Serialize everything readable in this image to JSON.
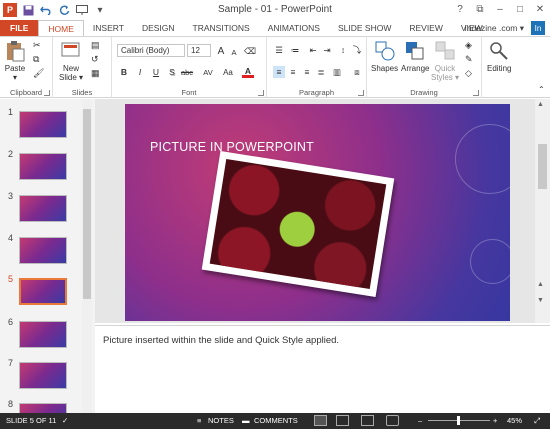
{
  "window": {
    "title": "Sample - 01 - PowerPoint"
  },
  "quick_access": {
    "app_icon": "P",
    "icons": [
      "save-icon",
      "undo-icon",
      "redo-icon",
      "start-from-beginning-icon",
      "customize-qat-icon"
    ]
  },
  "window_controls": {
    "help": "?",
    "restore_ribbon": "⧉",
    "minimize": "–",
    "maximize": "□",
    "close": "✕"
  },
  "tabs": [
    "FILE",
    "HOME",
    "INSERT",
    "DESIGN",
    "TRANSITIONS",
    "ANIMATIONS",
    "SLIDE SHOW",
    "REVIEW",
    "VIEW"
  ],
  "active_tab": "HOME",
  "user": {
    "name": "Indezine .com ▾",
    "badge": "In"
  },
  "ribbon": {
    "clipboard": {
      "label": "Clipboard",
      "paste": "Paste",
      "paste_arrow": "▾"
    },
    "slides": {
      "label": "Slides",
      "new_slide": "New",
      "new_slide_line2": "Slide ▾"
    },
    "font": {
      "label": "Font",
      "font_name": "Calibri (Body)",
      "font_size": "12",
      "bold": "B",
      "italic": "I",
      "underline": "U",
      "shadow": "S",
      "strike": "abc",
      "spacing": "AV",
      "case": "Aa",
      "color": "A",
      "grow": "A",
      "shrink": "A"
    },
    "paragraph": {
      "label": "Paragraph"
    },
    "drawing": {
      "label": "Drawing",
      "shapes": "Shapes",
      "arrange": "Arrange",
      "quick_styles": "Quick",
      "quick_styles_line2": "Styles ▾"
    },
    "editing": {
      "label": "Editing",
      "editing_btn": "Editing"
    }
  },
  "slides": [
    {
      "num": "1"
    },
    {
      "num": "2"
    },
    {
      "num": "3"
    },
    {
      "num": "4"
    },
    {
      "num": "5",
      "selected": true
    },
    {
      "num": "6"
    },
    {
      "num": "7"
    },
    {
      "num": "8"
    }
  ],
  "current_slide": {
    "title": "PICTURE IN POWERPOINT"
  },
  "notes": {
    "text": "Picture inserted within the slide and Quick Style applied."
  },
  "status": {
    "slide_info": "SLIDE 5 OF 11",
    "notes": "NOTES",
    "comments": "COMMENTS",
    "zoom": "45%",
    "zoom_minus": "–",
    "zoom_plus": "+"
  },
  "colors": {
    "accent": "#d24726",
    "statusbar": "#2b2b2b",
    "selected_thumb": "#e87a3a"
  }
}
